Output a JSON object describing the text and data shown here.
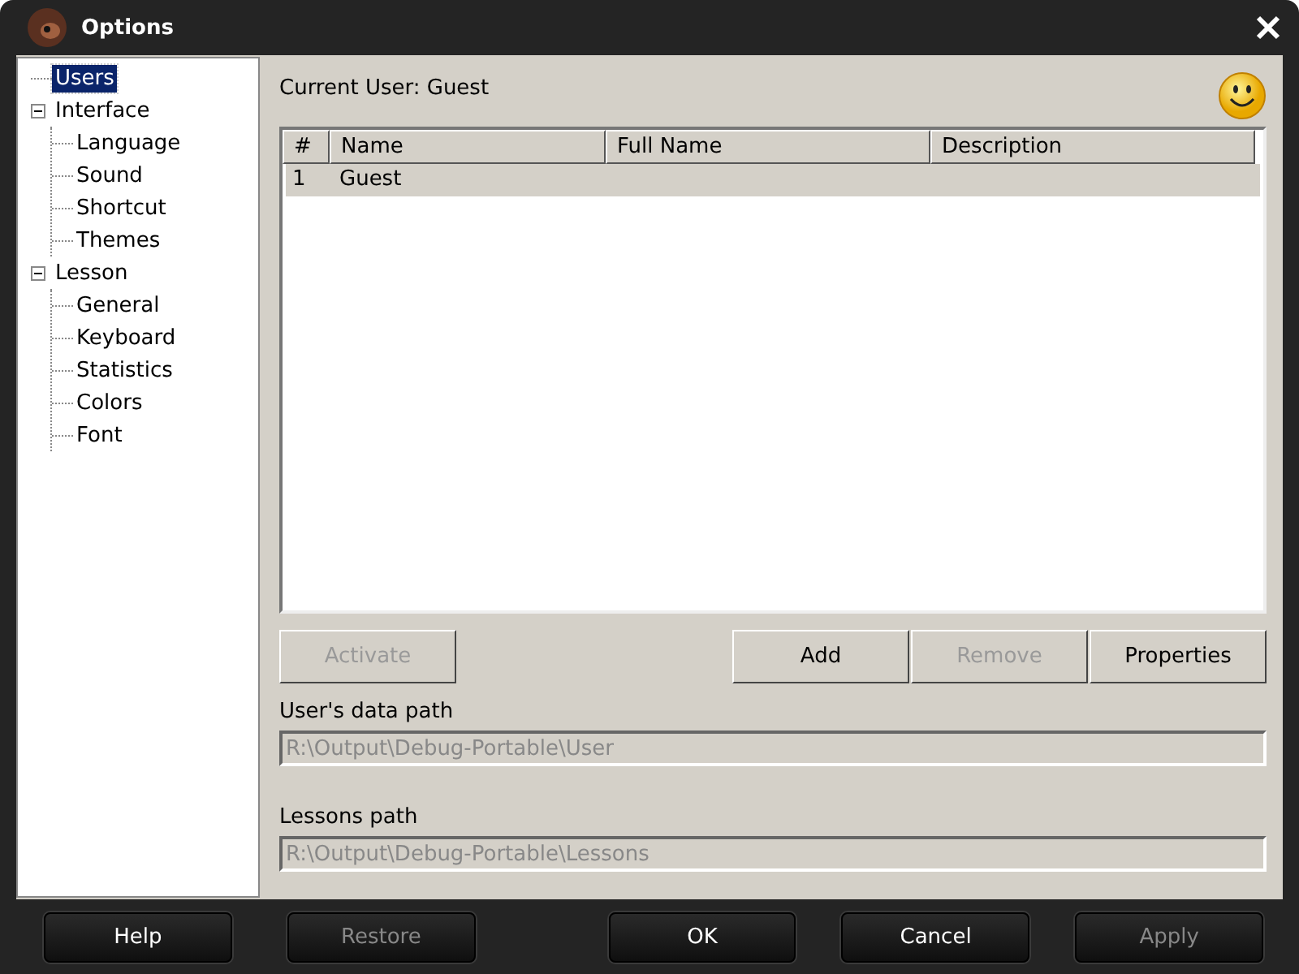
{
  "window": {
    "title": "Options"
  },
  "tree": [
    {
      "label": "Users",
      "selected": true
    },
    {
      "label": "Interface",
      "selected": false,
      "expanded": true,
      "children": [
        {
          "label": "Language",
          "selected": false
        },
        {
          "label": "Sound",
          "selected": false
        },
        {
          "label": "Shortcut",
          "selected": false
        },
        {
          "label": "Themes",
          "selected": false
        }
      ]
    },
    {
      "label": "Lesson",
      "selected": false,
      "expanded": true,
      "children": [
        {
          "label": "General",
          "selected": false
        },
        {
          "label": "Keyboard",
          "selected": false
        },
        {
          "label": "Statistics",
          "selected": false
        },
        {
          "label": "Colors",
          "selected": false
        },
        {
          "label": "Font",
          "selected": false
        }
      ]
    }
  ],
  "current_user": "Current User: Guest",
  "table": {
    "columns": [
      "#",
      "Name",
      "Full Name",
      "Description"
    ],
    "rows": [
      {
        "cells": [
          "1",
          "Guest",
          "",
          ""
        ],
        "selected": true
      }
    ]
  },
  "user_buttons": [
    {
      "label": "Activate",
      "disabled": true
    },
    {
      "label": "Add",
      "disabled": false
    },
    {
      "label": "Remove",
      "disabled": true
    },
    {
      "label": "Properties",
      "disabled": false
    }
  ],
  "fields": [
    {
      "label": "User's data path",
      "value": "R:\\Output\\Debug-Portable\\User"
    },
    {
      "label": "Lessons path",
      "value": "R:\\Output\\Debug-Portable\\Lessons"
    }
  ],
  "footer_buttons": [
    {
      "label": "Help",
      "disabled": false
    },
    {
      "label": "Restore",
      "disabled": true
    },
    {
      "label": "OK",
      "disabled": false
    },
    {
      "label": "Cancel",
      "disabled": false
    },
    {
      "label": "Apply",
      "disabled": true
    }
  ]
}
